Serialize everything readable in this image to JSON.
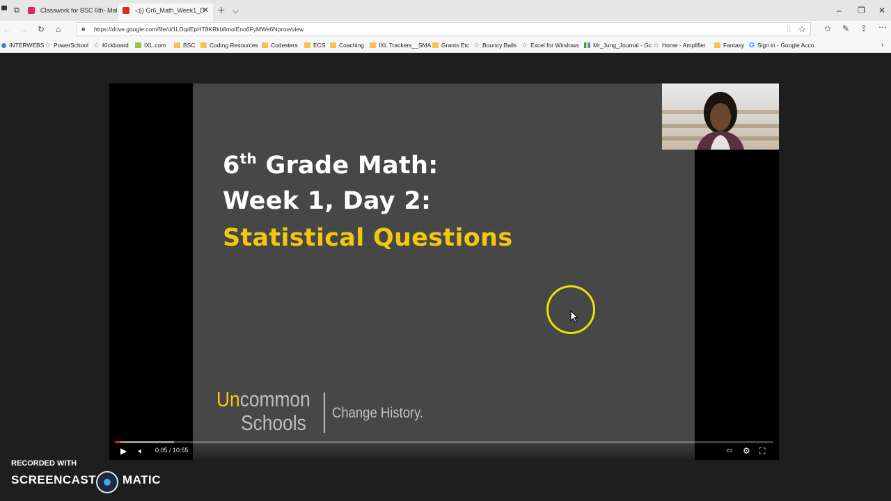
{
  "browser": {
    "tabs": [
      {
        "label": "Classwork for BSC 6th- Mat",
        "active": false
      },
      {
        "label": "Gr6_Math_Week1_D",
        "active": true
      }
    ],
    "url": "https://drive.google.com/file/d/1LDqdEpHT8KRkb8moiEno6FyMWe6Npnxe/view"
  },
  "bookmarks": [
    {
      "label": "INTERWEBS",
      "icon": "globe-icon"
    },
    {
      "label": "PowerSchool",
      "icon": "star-icon"
    },
    {
      "label": "Kickboard",
      "icon": "star-icon"
    },
    {
      "label": "IXL.com",
      "icon": "ixl-icon"
    },
    {
      "label": "BSC",
      "icon": "folder-icon"
    },
    {
      "label": "Coding Resources",
      "icon": "folder-icon"
    },
    {
      "label": "Codesters",
      "icon": "folder-icon"
    },
    {
      "label": "ECS",
      "icon": "folder-icon"
    },
    {
      "label": "Coaching",
      "icon": "folder-icon"
    },
    {
      "label": "IXL Trackers__SMA",
      "icon": "folder-icon"
    },
    {
      "label": "Grants Etc",
      "icon": "folder-icon"
    },
    {
      "label": "Bouncy Balls",
      "icon": "star-icon"
    },
    {
      "label": "Excel for Windows",
      "icon": "star-icon"
    },
    {
      "label": "Mr_Jung_Journal - Gc",
      "icon": "drive-icon"
    },
    {
      "label": "Home - Amplifier",
      "icon": "star-icon"
    },
    {
      "label": "Fantasy",
      "icon": "folder-icon"
    },
    {
      "label": "Sign in - Google Acco",
      "icon": "google-icon"
    }
  ],
  "slide": {
    "line1_main": "6",
    "line1_sup": "th",
    "line1_rest": " Grade Math:",
    "line2": "Week 1, Day 2:",
    "line3": "Statistical Questions",
    "logo_line1_highlight": "Un",
    "logo_line1_rest": "common",
    "logo_line2": "Schools",
    "tagline": "Change History."
  },
  "player": {
    "time": "0:05 / 10:55",
    "played_fraction": 0.008,
    "buffered_fraction": 0.09
  },
  "watermark": {
    "recorded_with": "RECORDED WITH",
    "brand_left": "SCREENCAST",
    "brand_right": "MATIC"
  },
  "colors": {
    "slide_bg": "#474747",
    "accent_yellow": "#f2c80f",
    "progress_red": "#e62117"
  }
}
